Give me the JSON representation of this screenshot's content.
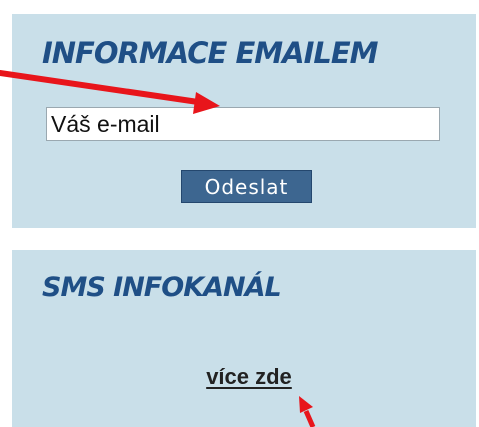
{
  "email_panel": {
    "title": "INFORMACE EMAILEM",
    "email_input": {
      "value": "",
      "placeholder": "Váš e-mail"
    },
    "submit_label": "Odeslat"
  },
  "sms_panel": {
    "title": "SMS INFOKANÁL",
    "more_link_label": "více zde"
  },
  "colors": {
    "panel_background": "#c9dfe9",
    "title_text": "#1f4f86",
    "button_background": "#3d6690",
    "annotation_arrow": "#e8151b"
  },
  "icons": {
    "annotation_arrow_top": "red-arrow-icon",
    "annotation_arrow_bottom": "red-arrow-icon"
  }
}
